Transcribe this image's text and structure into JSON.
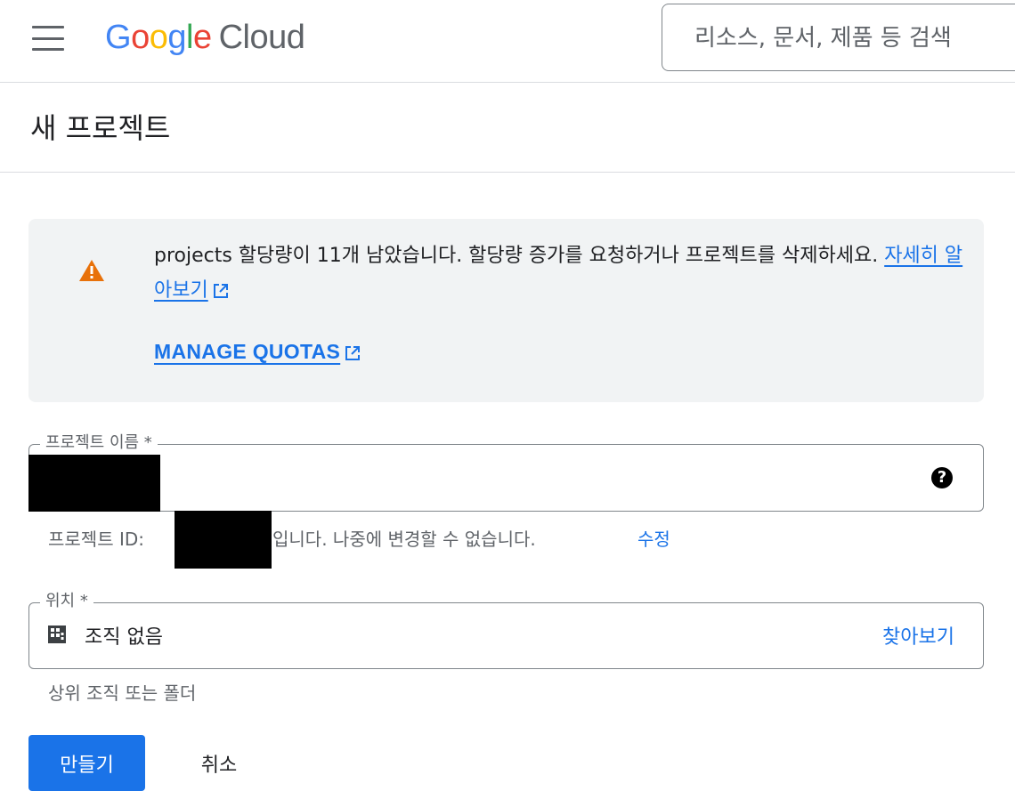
{
  "header": {
    "logo_google": [
      "G",
      "o",
      "o",
      "g",
      "l",
      "e"
    ],
    "logo_cloud": "Cloud",
    "search_placeholder": "리소스, 문서, 제품 등 검색"
  },
  "page": {
    "title": "새 프로젝트"
  },
  "alert": {
    "text": "projects 할당량이 11개 남았습니다. 할당량 증가를 요청하거나 프로젝트를 삭제하세요.",
    "learn_more": "자세히 알아보기",
    "manage_quotas": "MANAGE QUOTAS",
    "icon": "warning-icon",
    "icon_color": "#e8710a"
  },
  "form": {
    "name_label": "프로젝트 이름 *",
    "name_value": "",
    "project_id_prefix": "프로젝트 ID:",
    "project_id_suffix": "입니다. 나중에 변경할 수 없습니다.",
    "edit_link": "수정",
    "location_label": "위치 *",
    "location_value": "조직 없음",
    "browse": "찾아보기",
    "location_hint": "상위 조직 또는 폴더"
  },
  "actions": {
    "create": "만들기",
    "cancel": "취소"
  },
  "colors": {
    "accent": "#1a73e8",
    "alert_bg": "#f1f3f4"
  }
}
